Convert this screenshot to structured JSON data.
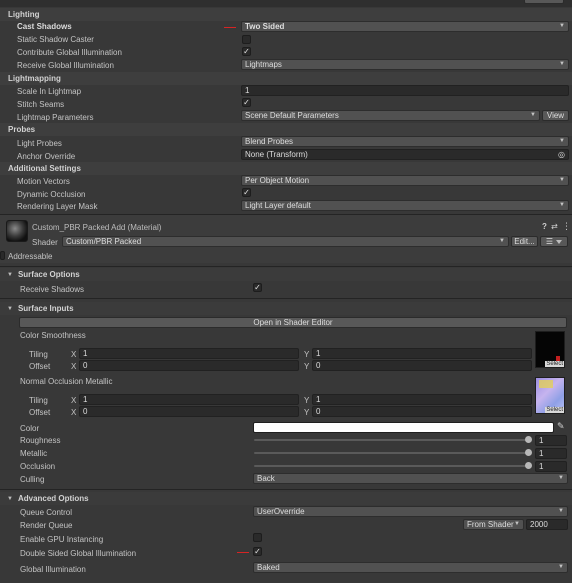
{
  "lighting": {
    "title": "Lighting",
    "cast_shadows_label": "Cast Shadows",
    "cast_shadows_value": "Two Sided",
    "static_shadow_caster_label": "Static Shadow Caster",
    "contribute_gi_label": "Contribute Global Illumination",
    "receive_gi_label": "Receive Global Illumination",
    "receive_gi_value": "Lightmaps"
  },
  "lightmapping": {
    "title": "Lightmapping",
    "scale_label": "Scale In Lightmap",
    "scale_value": "1",
    "stitch_label": "Stitch Seams",
    "params_label": "Lightmap Parameters",
    "params_value": "Scene Default Parameters",
    "view_button": "View"
  },
  "probes": {
    "title": "Probes",
    "light_probes_label": "Light Probes",
    "light_probes_value": "Blend Probes",
    "anchor_label": "Anchor Override",
    "anchor_value": "None (Transform)"
  },
  "additional": {
    "title": "Additional Settings",
    "motion_label": "Motion Vectors",
    "motion_value": "Per Object Motion",
    "dynamic_label": "Dynamic Occlusion",
    "layer_label": "Rendering Layer Mask",
    "layer_value": "Light Layer default"
  },
  "material": {
    "name": "Custom_PBR Packed Add (Material)",
    "shader_label": "Shader",
    "shader_value": "Custom/PBR Packed",
    "edit_button": "Edit...",
    "addressable_label": "Addressable"
  },
  "surface_options": {
    "title": "Surface Options",
    "receive_shadows_label": "Receive Shadows"
  },
  "surface_inputs": {
    "title": "Surface Inputs",
    "open_editor_button": "Open in Shader Editor",
    "color_smoothness_label": "Color Smoothness",
    "tiling_label": "Tiling",
    "offset_label": "Offset",
    "x_label": "X",
    "y_label": "Y",
    "cs_tiling_x": "1",
    "cs_tiling_y": "1",
    "cs_offset_x": "0",
    "cs_offset_y": "0",
    "normal_label": "Normal Occlusion Metallic",
    "no_tiling_x": "1",
    "no_tiling_y": "1",
    "no_offset_x": "0",
    "no_offset_y": "0",
    "select_label": "Select",
    "color_label": "Color",
    "roughness_label": "Roughness",
    "roughness_value": "1",
    "metallic_label": "Metallic",
    "metallic_value": "1",
    "occlusion_label": "Occlusion",
    "occlusion_value": "1",
    "culling_label": "Culling",
    "culling_value": "Back"
  },
  "advanced": {
    "title": "Advanced Options",
    "queue_control_label": "Queue Control",
    "queue_control_value": "UserOverride",
    "render_queue_label": "Render Queue",
    "render_queue_source": "From Shader",
    "render_queue_value": "2000",
    "gpu_instancing_label": "Enable GPU Instancing",
    "double_sided_gi_label": "Double Sided Global Illumination",
    "global_illum_label": "Global Illumination",
    "global_illum_value": "Baked"
  },
  "icons": {
    "check": "✓",
    "help": "?",
    "settings": "⇄",
    "menu": "⋮",
    "target": "◎",
    "eyedropper": "✎"
  }
}
